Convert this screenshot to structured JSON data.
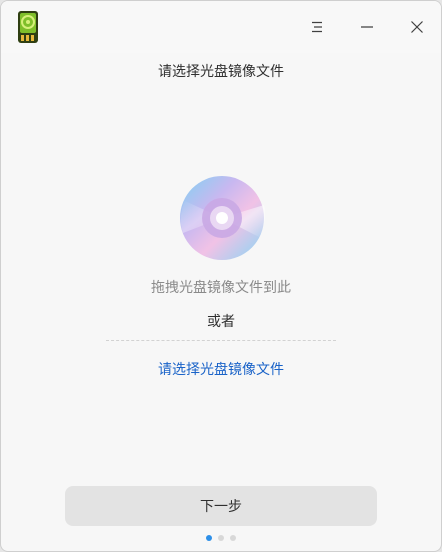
{
  "titlebar": {
    "app_icon": "disc-writer-app-icon",
    "menu_icon": "hamburger-menu-icon",
    "minimize_icon": "minimize-icon",
    "close_icon": "close-icon"
  },
  "main": {
    "heading": "请选择光盘镜像文件",
    "disc_icon": "cd-disc-icon",
    "drag_hint": "拖拽光盘镜像文件到此",
    "or_text": "或者",
    "select_link": "请选择光盘镜像文件"
  },
  "footer": {
    "next_button": "下一步",
    "steps": [
      {
        "state": "active"
      },
      {
        "state": "inactive"
      },
      {
        "state": "inactive"
      }
    ]
  },
  "colors": {
    "link": "#1a63c8",
    "active_step": "#2d8fe8",
    "button_bg": "#e3e3e3"
  }
}
